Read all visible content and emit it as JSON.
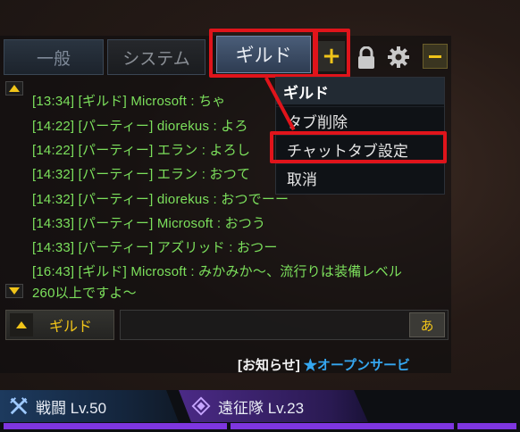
{
  "tabs": [
    {
      "label": "一般"
    },
    {
      "label": "システム"
    },
    {
      "label": "ギルド",
      "active": true
    }
  ],
  "toolbar": {
    "add_label": "+",
    "lock_icon": "lock-icon",
    "gear_icon": "gear-icon",
    "minimize_icon": "minus-icon"
  },
  "chat_lines": [
    "[13:34] [ギルド] Microsoft : ちゃ",
    "[14:22] [パーティー] diorekus : よろ",
    "[14:22] [パーティー] エラン : よろし",
    "[14:32] [パーティー] エラン : おつて",
    "[14:32] [パーティー] diorekus : おつでーー",
    "[14:33] [パーティー] Microsoft : おつう",
    "[14:33] [パーティー] アズリッド : おつー",
    "[16:43] [ギルド] Microsoft : みかみか〜、流行りは装備レベル",
    "260以上ですよ〜"
  ],
  "context_menu": {
    "header": "ギルド",
    "items": [
      "タブ削除",
      "チャットタブ設定",
      "取消"
    ]
  },
  "input": {
    "channel": "ギルド",
    "ime_label": "あ"
  },
  "notice": {
    "tag": "[お知らせ]",
    "message": "★オープンサービ"
  },
  "status": {
    "battle_label": "戦闘 Lv.50",
    "expedition_label": "遠征隊 Lv.23"
  },
  "colors": {
    "highlight": "#e0141b",
    "chat_text": "#7ce05c",
    "accent_yellow": "#f0c419",
    "notice_blue": "#35a7f0",
    "xp_purple": "#7e36e0"
  }
}
